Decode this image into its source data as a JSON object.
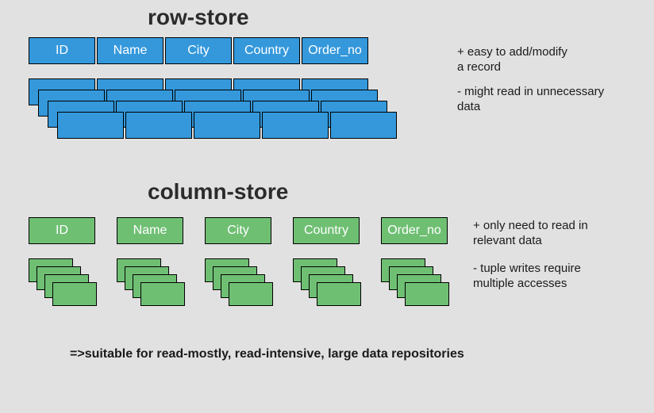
{
  "row_store": {
    "title": "row-store",
    "headers": [
      "ID",
      "Name",
      "City",
      "Country",
      "Order_no"
    ],
    "note_pro": "+ easy to add/modify\n    a record",
    "note_con": "- might read in unnecessary\n    data"
  },
  "column_store": {
    "title": "column-store",
    "headers": [
      "ID",
      "Name",
      "City",
      "Country",
      "Order_no"
    ],
    "note_pro": "+ only need to read in\n    relevant data",
    "note_con": "- tuple writes require\n    multiple accesses",
    "conclusion": "=>suitable for read-mostly, read-intensive, large data repositories"
  },
  "chart_data": {
    "type": "table",
    "title": "Row-store vs Column-store layout comparison",
    "tables": [
      {
        "name": "row-store",
        "columns": [
          "ID",
          "Name",
          "City",
          "Country",
          "Order_no"
        ],
        "layout": "rows",
        "data_row_count": 4,
        "pros": [
          "easy to add/modify a record"
        ],
        "cons": [
          "might read in unnecessary data"
        ]
      },
      {
        "name": "column-store",
        "columns": [
          "ID",
          "Name",
          "City",
          "Country",
          "Order_no"
        ],
        "layout": "columns",
        "data_items_per_column": 4,
        "pros": [
          "only need to read in relevant data"
        ],
        "cons": [
          "tuple writes require multiple accesses"
        ],
        "conclusion": "suitable for read-mostly, read-intensive, large data repositories"
      }
    ]
  }
}
